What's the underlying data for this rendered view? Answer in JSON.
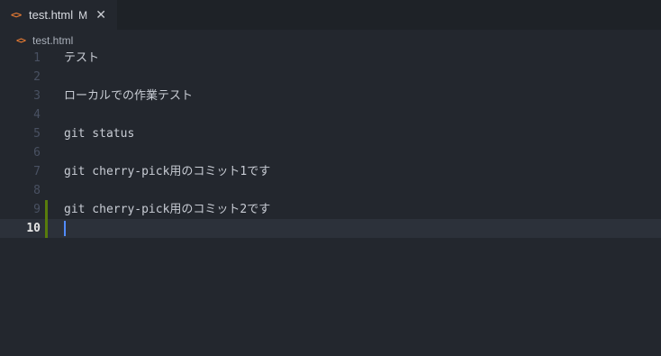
{
  "tab": {
    "icon": "code-brackets-icon",
    "icon_glyph": "<>",
    "filename": "test.html",
    "status": "M",
    "close_glyph": "✕"
  },
  "breadcrumb": {
    "icon_glyph": "<>",
    "filename": "test.html"
  },
  "colors": {
    "editor_bg": "#23272e",
    "tabbar_bg": "#1e2227",
    "file_icon": "#e37933",
    "git_added": "#587c0c",
    "cursor": "#528bff"
  },
  "editor": {
    "active_line": 10,
    "lines": [
      {
        "num": "1",
        "text": "テスト"
      },
      {
        "num": "2",
        "text": ""
      },
      {
        "num": "3",
        "text": "ローカルでの作業テスト"
      },
      {
        "num": "4",
        "text": ""
      },
      {
        "num": "5",
        "text": "git status"
      },
      {
        "num": "6",
        "text": ""
      },
      {
        "num": "7",
        "text": "git cherry-pick用のコミット1です"
      },
      {
        "num": "8",
        "text": ""
      },
      {
        "num": "9",
        "text": "git cherry-pick用のコミット2です"
      },
      {
        "num": "10",
        "text": ""
      }
    ]
  }
}
